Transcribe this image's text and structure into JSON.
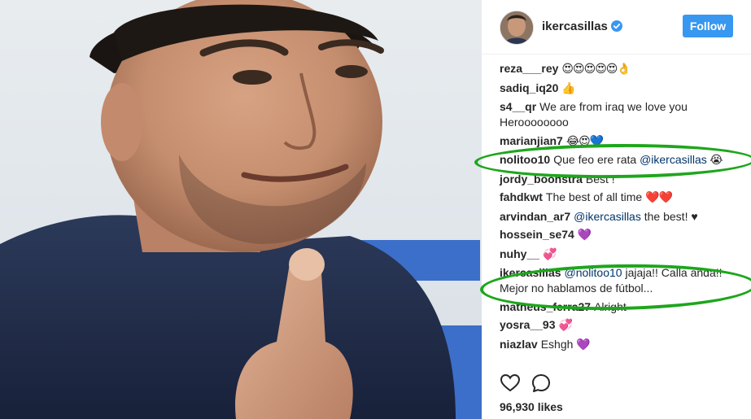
{
  "post": {
    "username": "ikercasillas",
    "verified": true,
    "follow_label": "Follow",
    "likes_label": "96,930 likes"
  },
  "comments": [
    {
      "author": "reza___rey",
      "parts": [
        {
          "t": "emoji",
          "v": "😍😍😍😍😍👌"
        }
      ]
    },
    {
      "author": "sadiq_iq20",
      "parts": [
        {
          "t": "emoji",
          "v": "👍"
        }
      ]
    },
    {
      "author": "s4__qr",
      "parts": [
        {
          "t": "text",
          "v": "We are from iraq we love you Heroooooooo"
        }
      ]
    },
    {
      "author": "marianjian7",
      "parts": [
        {
          "t": "emoji",
          "v": "😂😍💙"
        }
      ]
    },
    {
      "author": "nolitoo10",
      "parts": [
        {
          "t": "text",
          "v": "Que feo ere rata "
        },
        {
          "t": "mention",
          "v": "@ikercasillas"
        },
        {
          "t": "emoji",
          "v": " 😭"
        }
      ]
    },
    {
      "author": "jordy_boonstra",
      "parts": [
        {
          "t": "text",
          "v": "Best !"
        }
      ]
    },
    {
      "author": "fahdkwt",
      "parts": [
        {
          "t": "text",
          "v": "The best of all time "
        },
        {
          "t": "emoji",
          "v": "❤️❤️"
        }
      ]
    },
    {
      "author": "arvindan_ar7",
      "parts": [
        {
          "t": "mention",
          "v": "@ikercasillas"
        },
        {
          "t": "text",
          "v": " the best! ♥"
        }
      ]
    },
    {
      "author": "hossein_se74",
      "parts": [
        {
          "t": "emoji",
          "v": "💜"
        }
      ]
    },
    {
      "author": "nuhy__",
      "parts": [
        {
          "t": "emoji",
          "v": "💞"
        }
      ]
    },
    {
      "author": "ikercasillas",
      "parts": [
        {
          "t": "mention",
          "v": "@nolitoo10"
        },
        {
          "t": "text",
          "v": " jajaja!! Calla anda!! Mejor no hablamos de fútbol..."
        }
      ]
    },
    {
      "author": "matheus_ferra27",
      "parts": [
        {
          "t": "text",
          "v": "Alright"
        }
      ]
    },
    {
      "author": "yosra__93",
      "parts": [
        {
          "t": "emoji",
          "v": "💞"
        }
      ]
    },
    {
      "author": "niazlav",
      "parts": [
        {
          "t": "text",
          "v": "Eshgh "
        },
        {
          "t": "emoji",
          "v": "💜"
        }
      ]
    }
  ],
  "icons": {
    "verified": "verified-badge-icon",
    "like": "heart-outline-icon",
    "comment": "speech-bubble-icon"
  },
  "colors": {
    "follow_button": "#3897f0",
    "marker": "#1ea61c",
    "mention": "#003569",
    "text": "#262626"
  }
}
